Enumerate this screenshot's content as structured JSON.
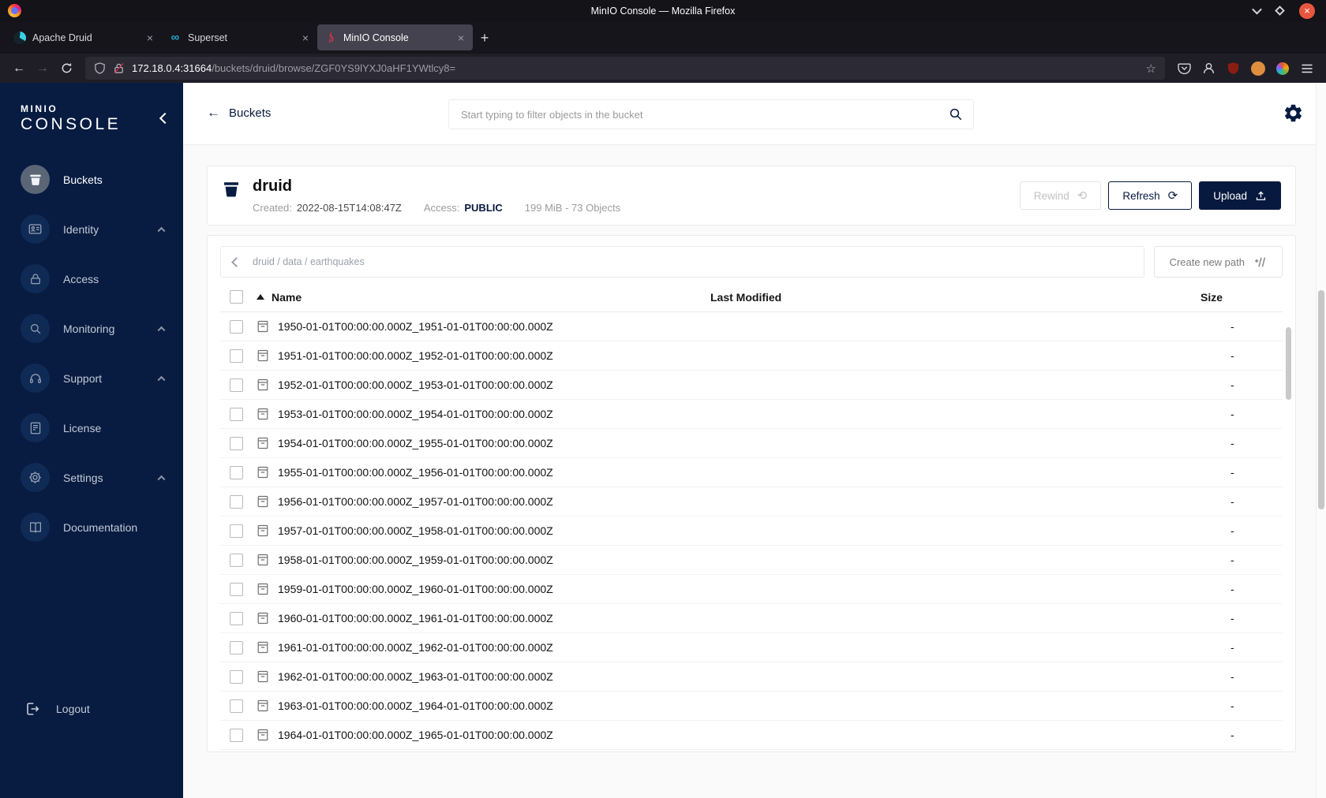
{
  "window": {
    "title": "MinIO Console — Mozilla Firefox"
  },
  "glyphs": {
    "close": "×",
    "plus": "+",
    "back": "←",
    "forward": "→",
    "star": "☆",
    "refresh": "⟳",
    "rewind": "⟲",
    "infinity": "∞"
  },
  "browser": {
    "tabs": [
      {
        "label": "Apache Druid"
      },
      {
        "label": "Superset"
      },
      {
        "label": "MinIO Console"
      }
    ],
    "url": {
      "host": "172.18.0.4:31664",
      "path": "/buckets/druid/browse/ZGF0YS9lYXJ0aHF1YWtlcy8="
    }
  },
  "sidebar": {
    "logo_line1": "MINIO",
    "logo_line2": "CONSOLE",
    "items": [
      {
        "label": "Buckets"
      },
      {
        "label": "Identity"
      },
      {
        "label": "Access"
      },
      {
        "label": "Monitoring"
      },
      {
        "label": "Support"
      },
      {
        "label": "License"
      },
      {
        "label": "Settings"
      },
      {
        "label": "Documentation"
      }
    ],
    "logout": "Logout"
  },
  "header": {
    "back": "Buckets",
    "search_placeholder": "Start typing to filter objects in the bucket"
  },
  "bucket": {
    "name": "druid",
    "created_label": "Created:",
    "created": "2022-08-15T14:08:47Z",
    "access_label": "Access:",
    "access": "PUBLIC",
    "usage": "199 MiB - 73 Objects",
    "buttons": {
      "rewind": "Rewind",
      "refresh": "Refresh",
      "upload": "Upload"
    }
  },
  "browse": {
    "path": [
      "druid",
      "data",
      "earthquakes"
    ],
    "create_path": "Create new path",
    "columns": {
      "name": "Name",
      "modified": "Last Modified",
      "size": "Size"
    },
    "rows": [
      {
        "name": "1950-01-01T00:00:00.000Z_1951-01-01T00:00:00.000Z",
        "size": "-"
      },
      {
        "name": "1951-01-01T00:00:00.000Z_1952-01-01T00:00:00.000Z",
        "size": "-"
      },
      {
        "name": "1952-01-01T00:00:00.000Z_1953-01-01T00:00:00.000Z",
        "size": "-"
      },
      {
        "name": "1953-01-01T00:00:00.000Z_1954-01-01T00:00:00.000Z",
        "size": "-"
      },
      {
        "name": "1954-01-01T00:00:00.000Z_1955-01-01T00:00:00.000Z",
        "size": "-"
      },
      {
        "name": "1955-01-01T00:00:00.000Z_1956-01-01T00:00:00.000Z",
        "size": "-"
      },
      {
        "name": "1956-01-01T00:00:00.000Z_1957-01-01T00:00:00.000Z",
        "size": "-"
      },
      {
        "name": "1957-01-01T00:00:00.000Z_1958-01-01T00:00:00.000Z",
        "size": "-"
      },
      {
        "name": "1958-01-01T00:00:00.000Z_1959-01-01T00:00:00.000Z",
        "size": "-"
      },
      {
        "name": "1959-01-01T00:00:00.000Z_1960-01-01T00:00:00.000Z",
        "size": "-"
      },
      {
        "name": "1960-01-01T00:00:00.000Z_1961-01-01T00:00:00.000Z",
        "size": "-"
      },
      {
        "name": "1961-01-01T00:00:00.000Z_1962-01-01T00:00:00.000Z",
        "size": "-"
      },
      {
        "name": "1962-01-01T00:00:00.000Z_1963-01-01T00:00:00.000Z",
        "size": "-"
      },
      {
        "name": "1963-01-01T00:00:00.000Z_1964-01-01T00:00:00.000Z",
        "size": "-"
      },
      {
        "name": "1964-01-01T00:00:00.000Z_1965-01-01T00:00:00.000Z",
        "size": "-"
      }
    ]
  }
}
